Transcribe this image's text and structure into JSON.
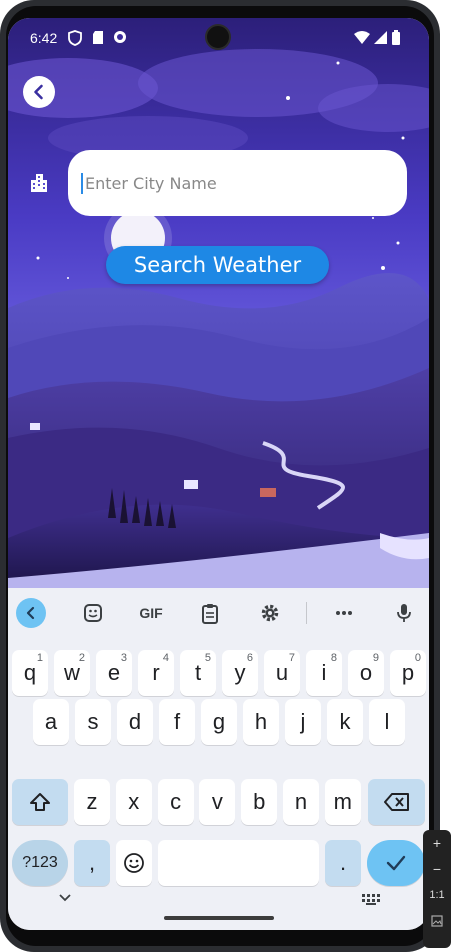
{
  "status_bar": {
    "time": "6:42",
    "icons": [
      "vpn-shield-icon",
      "sd-card-icon",
      "sync-icon",
      "wifi-icon",
      "signal-icon",
      "battery-icon"
    ]
  },
  "header": {
    "back_icon": "chevron-left-icon"
  },
  "city_field": {
    "icon": "building-icon",
    "placeholder": "Enter City Name",
    "value": ""
  },
  "search_button": {
    "label": "Search Weather"
  },
  "colors": {
    "accent": "#1e88e5",
    "keyboard_bg": "#eef0f6",
    "key_highlight": "#6ec3f3"
  },
  "keyboard": {
    "toolbar": [
      {
        "name": "collapse",
        "icon": "chevron-left-icon"
      },
      {
        "name": "sticker",
        "icon": "sticker-icon"
      },
      {
        "name": "gif",
        "label": "GIF"
      },
      {
        "name": "clipboard",
        "icon": "clipboard-icon"
      },
      {
        "name": "settings",
        "icon": "gear-icon"
      },
      {
        "name": "more",
        "icon": "more-icon"
      },
      {
        "name": "voice",
        "icon": "mic-icon"
      }
    ],
    "row1": [
      {
        "key": "q",
        "hint": "1"
      },
      {
        "key": "w",
        "hint": "2"
      },
      {
        "key": "e",
        "hint": "3"
      },
      {
        "key": "r",
        "hint": "4"
      },
      {
        "key": "t",
        "hint": "5"
      },
      {
        "key": "y",
        "hint": "6"
      },
      {
        "key": "u",
        "hint": "7"
      },
      {
        "key": "i",
        "hint": "8"
      },
      {
        "key": "o",
        "hint": "9"
      },
      {
        "key": "p",
        "hint": "0"
      }
    ],
    "row2": [
      "a",
      "s",
      "d",
      "f",
      "g",
      "h",
      "j",
      "k",
      "l"
    ],
    "row3": [
      "z",
      "x",
      "c",
      "v",
      "b",
      "n",
      "m"
    ],
    "symbols_label": "?123",
    "comma": ",",
    "period": ".",
    "shift_icon": "shift-icon",
    "backspace_icon": "backspace-icon",
    "emoji_icon": "emoji-icon",
    "enter_icon": "check-icon"
  },
  "emulator_controls": {
    "plus": "+",
    "minus": "−",
    "ratio": "1:1"
  }
}
